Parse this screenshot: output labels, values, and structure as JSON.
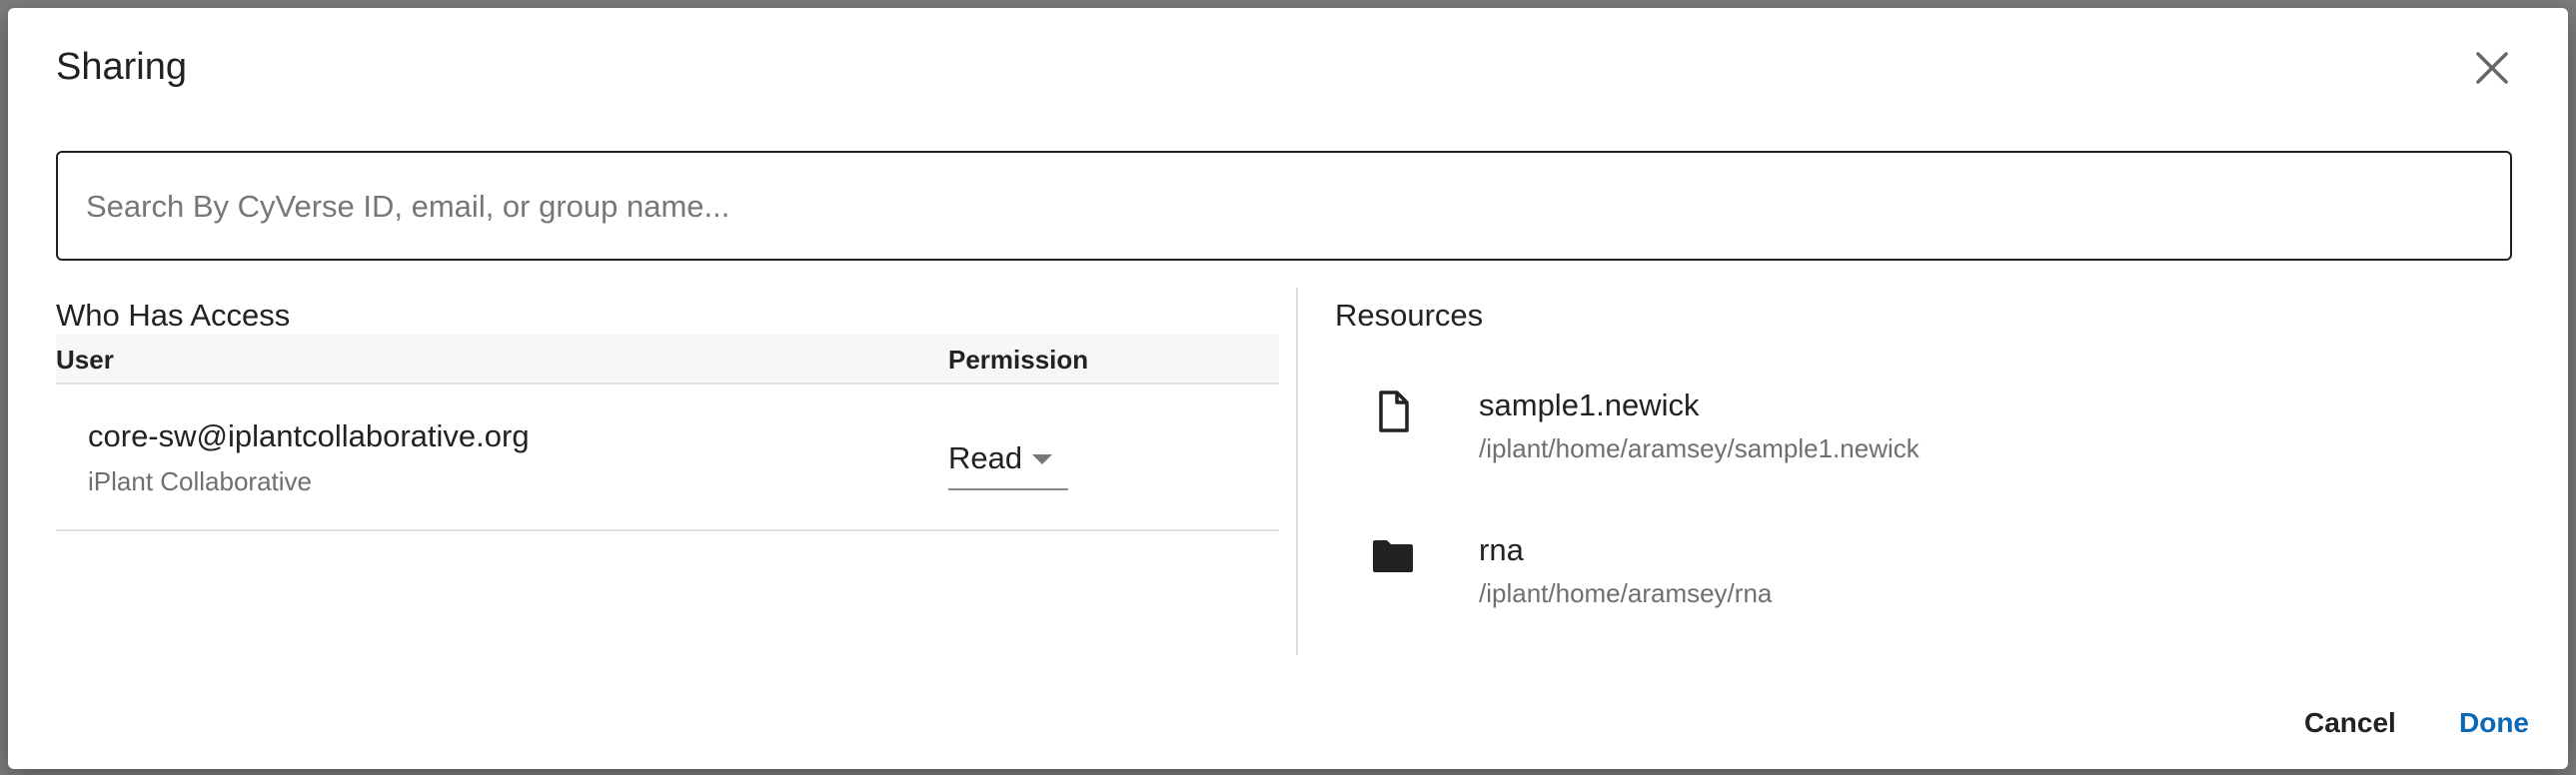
{
  "dialog": {
    "title": "Sharing",
    "close_icon": "close-icon"
  },
  "search": {
    "placeholder": "Search By CyVerse ID, email, or group name...",
    "value": ""
  },
  "who_has_access": {
    "title": "Who Has Access",
    "columns": [
      "User",
      "Permission"
    ],
    "rows": [
      {
        "email": "core-sw@iplantcollaborative.org",
        "name": "iPlant Collaborative",
        "permission": "Read"
      }
    ]
  },
  "resources": {
    "title": "Resources",
    "items": [
      {
        "icon": "file-icon",
        "name": "sample1.newick",
        "path": "/iplant/home/aramsey/sample1.newick"
      },
      {
        "icon": "folder-icon",
        "name": "rna",
        "path": "/iplant/home/aramsey/rna"
      }
    ]
  },
  "footer": {
    "cancel_label": "Cancel",
    "done_label": "Done"
  },
  "colors": {
    "primary": "#0a68b4",
    "text": "#222222",
    "secondary_text": "#6f6f6f"
  }
}
